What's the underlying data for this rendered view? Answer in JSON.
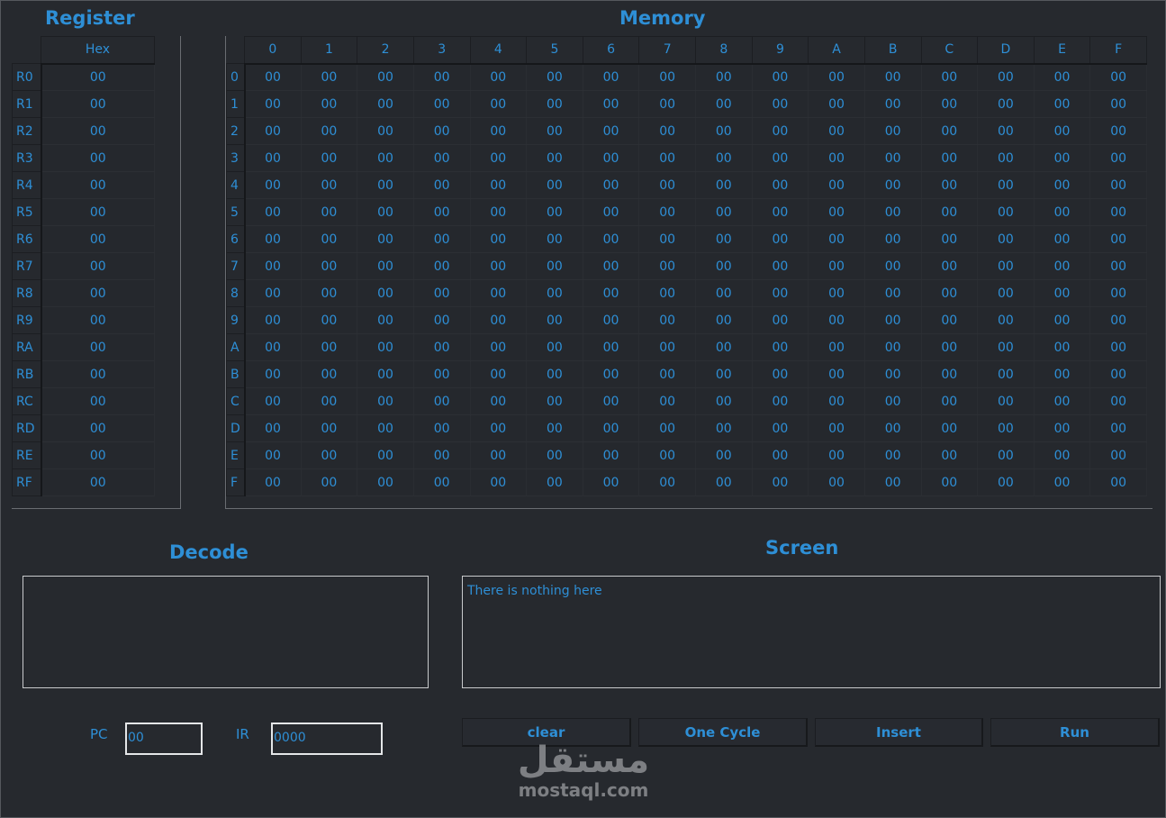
{
  "titles": {
    "register": "Register",
    "memory": "Memory",
    "decode": "Decode",
    "screen": "Screen"
  },
  "registers": {
    "header": "Hex",
    "rows": [
      {
        "name": "R0",
        "value": "00"
      },
      {
        "name": "R1",
        "value": "00"
      },
      {
        "name": "R2",
        "value": "00"
      },
      {
        "name": "R3",
        "value": "00"
      },
      {
        "name": "R4",
        "value": "00"
      },
      {
        "name": "R5",
        "value": "00"
      },
      {
        "name": "R6",
        "value": "00"
      },
      {
        "name": "R7",
        "value": "00"
      },
      {
        "name": "R8",
        "value": "00"
      },
      {
        "name": "R9",
        "value": "00"
      },
      {
        "name": "RA",
        "value": "00"
      },
      {
        "name": "RB",
        "value": "00"
      },
      {
        "name": "RC",
        "value": "00"
      },
      {
        "name": "RD",
        "value": "00"
      },
      {
        "name": "RE",
        "value": "00"
      },
      {
        "name": "RF",
        "value": "00"
      }
    ]
  },
  "memory": {
    "columns": [
      "0",
      "1",
      "2",
      "3",
      "4",
      "5",
      "6",
      "7",
      "8",
      "9",
      "A",
      "B",
      "C",
      "D",
      "E",
      "F"
    ],
    "rows": [
      {
        "label": "0",
        "cells": [
          "00",
          "00",
          "00",
          "00",
          "00",
          "00",
          "00",
          "00",
          "00",
          "00",
          "00",
          "00",
          "00",
          "00",
          "00",
          "00"
        ]
      },
      {
        "label": "1",
        "cells": [
          "00",
          "00",
          "00",
          "00",
          "00",
          "00",
          "00",
          "00",
          "00",
          "00",
          "00",
          "00",
          "00",
          "00",
          "00",
          "00"
        ]
      },
      {
        "label": "2",
        "cells": [
          "00",
          "00",
          "00",
          "00",
          "00",
          "00",
          "00",
          "00",
          "00",
          "00",
          "00",
          "00",
          "00",
          "00",
          "00",
          "00"
        ]
      },
      {
        "label": "3",
        "cells": [
          "00",
          "00",
          "00",
          "00",
          "00",
          "00",
          "00",
          "00",
          "00",
          "00",
          "00",
          "00",
          "00",
          "00",
          "00",
          "00"
        ]
      },
      {
        "label": "4",
        "cells": [
          "00",
          "00",
          "00",
          "00",
          "00",
          "00",
          "00",
          "00",
          "00",
          "00",
          "00",
          "00",
          "00",
          "00",
          "00",
          "00"
        ]
      },
      {
        "label": "5",
        "cells": [
          "00",
          "00",
          "00",
          "00",
          "00",
          "00",
          "00",
          "00",
          "00",
          "00",
          "00",
          "00",
          "00",
          "00",
          "00",
          "00"
        ]
      },
      {
        "label": "6",
        "cells": [
          "00",
          "00",
          "00",
          "00",
          "00",
          "00",
          "00",
          "00",
          "00",
          "00",
          "00",
          "00",
          "00",
          "00",
          "00",
          "00"
        ]
      },
      {
        "label": "7",
        "cells": [
          "00",
          "00",
          "00",
          "00",
          "00",
          "00",
          "00",
          "00",
          "00",
          "00",
          "00",
          "00",
          "00",
          "00",
          "00",
          "00"
        ]
      },
      {
        "label": "8",
        "cells": [
          "00",
          "00",
          "00",
          "00",
          "00",
          "00",
          "00",
          "00",
          "00",
          "00",
          "00",
          "00",
          "00",
          "00",
          "00",
          "00"
        ]
      },
      {
        "label": "9",
        "cells": [
          "00",
          "00",
          "00",
          "00",
          "00",
          "00",
          "00",
          "00",
          "00",
          "00",
          "00",
          "00",
          "00",
          "00",
          "00",
          "00"
        ]
      },
      {
        "label": "A",
        "cells": [
          "00",
          "00",
          "00",
          "00",
          "00",
          "00",
          "00",
          "00",
          "00",
          "00",
          "00",
          "00",
          "00",
          "00",
          "00",
          "00"
        ]
      },
      {
        "label": "B",
        "cells": [
          "00",
          "00",
          "00",
          "00",
          "00",
          "00",
          "00",
          "00",
          "00",
          "00",
          "00",
          "00",
          "00",
          "00",
          "00",
          "00"
        ]
      },
      {
        "label": "C",
        "cells": [
          "00",
          "00",
          "00",
          "00",
          "00",
          "00",
          "00",
          "00",
          "00",
          "00",
          "00",
          "00",
          "00",
          "00",
          "00",
          "00"
        ]
      },
      {
        "label": "D",
        "cells": [
          "00",
          "00",
          "00",
          "00",
          "00",
          "00",
          "00",
          "00",
          "00",
          "00",
          "00",
          "00",
          "00",
          "00",
          "00",
          "00"
        ]
      },
      {
        "label": "E",
        "cells": [
          "00",
          "00",
          "00",
          "00",
          "00",
          "00",
          "00",
          "00",
          "00",
          "00",
          "00",
          "00",
          "00",
          "00",
          "00",
          "00"
        ]
      },
      {
        "label": "F",
        "cells": [
          "00",
          "00",
          "00",
          "00",
          "00",
          "00",
          "00",
          "00",
          "00",
          "00",
          "00",
          "00",
          "00",
          "00",
          "00",
          "00"
        ]
      }
    ]
  },
  "decode": {
    "text": ""
  },
  "screen": {
    "text": "There is nothing here"
  },
  "pc": {
    "label": "PC",
    "value": "00"
  },
  "ir": {
    "label": "IR",
    "value": "0000"
  },
  "buttons": {
    "clear": "clear",
    "one_cycle": "One Cycle",
    "insert": "Insert",
    "run": "Run"
  },
  "watermark": {
    "arabic": "مستقل",
    "latin": "mostaql.com"
  },
  "colors": {
    "background": "#26292e",
    "accent": "#2e8fd6",
    "border": "#c8cacc"
  }
}
